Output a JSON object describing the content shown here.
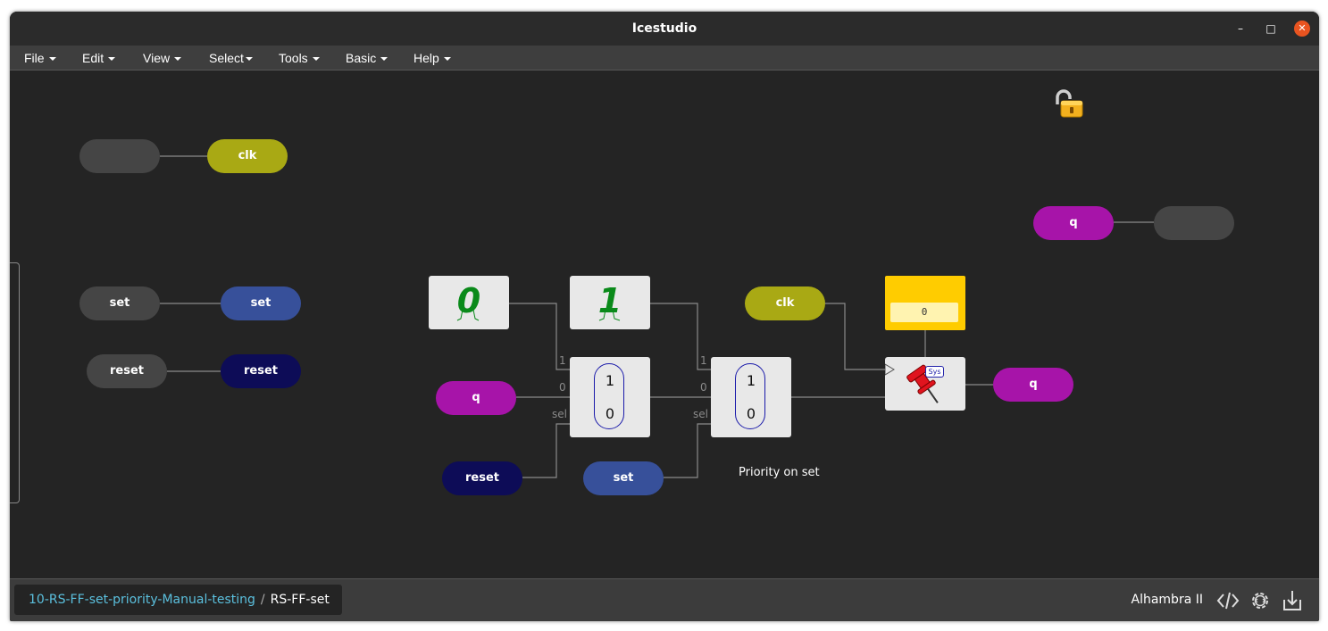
{
  "window": {
    "title": "Icestudio",
    "minimize_glyph": "–",
    "maximize_glyph": "□",
    "close_glyph": "✕"
  },
  "menu": [
    "File",
    "Edit",
    "View",
    "Select",
    "Tools",
    "Basic",
    "Help"
  ],
  "canvas": {
    "lock_icon": "unlocked-padlock-icon",
    "ports": {
      "clk_in_name": "",
      "clk_in_label": "clk",
      "set_in_name": "set",
      "set_in_label": "set",
      "reset_in_name": "reset",
      "reset_in_label": "reset",
      "q_out_label": "q",
      "q_out_name": ""
    },
    "circuit": {
      "const0": "0",
      "const1": "1",
      "q_label": "q",
      "reset_label": "reset",
      "set_label": "set",
      "clk_label": "clk",
      "q_out_label": "q",
      "mux_top": "1",
      "mux_bottom": "0",
      "pin_1": "1",
      "pin_0": "0",
      "pin_sel": "sel",
      "memory_value": "0",
      "dff_badge": "Sys",
      "comment": "Priority on set"
    },
    "colors": {
      "dark_pill": "#454545",
      "clk": "#a9a914",
      "set": "#37509a",
      "reset": "#0d0c57",
      "q": "#a714a9",
      "memory": "#ffcc00",
      "wire": "#8a8a8a"
    }
  },
  "status": {
    "breadcrumb_parent": "10-RS-FF-set-priority-Manual-testing",
    "breadcrumb_sep": "/",
    "breadcrumb_current": "RS-FF-set",
    "board": "Alhambra II",
    "icons": [
      "code-icon",
      "settings-icon",
      "download-icon"
    ]
  }
}
